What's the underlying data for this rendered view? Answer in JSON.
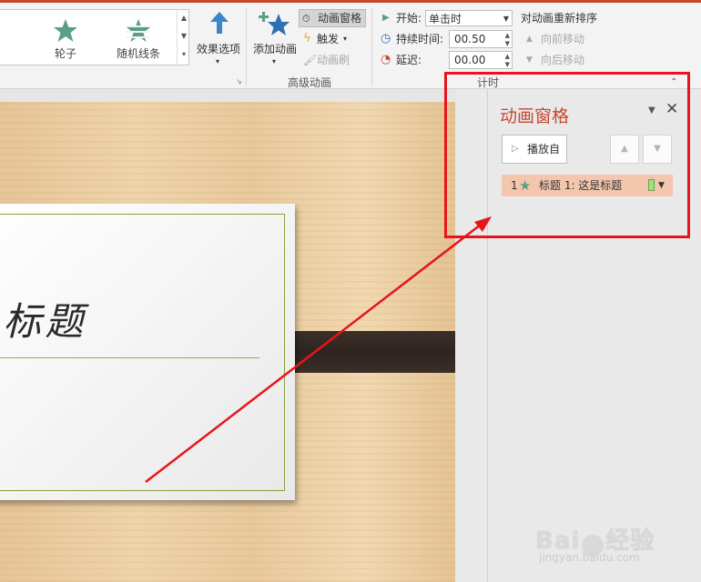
{
  "ribbon": {
    "gallery": {
      "items": [
        {
          "label": "轮子",
          "icon": "wheel-star-icon"
        },
        {
          "label": "随机线条",
          "icon": "random-bars-star-icon"
        }
      ]
    },
    "effect_options_label": "效果选项",
    "add_animation_label": "添加动画",
    "advanced": {
      "animation_pane_label": "动画窗格",
      "trigger_label": "触发",
      "painter_label": "动画刷",
      "group_label": "高级动画"
    },
    "timing": {
      "start_label": "开始:",
      "start_value": "单击时",
      "duration_label": "持续时间:",
      "duration_value": "00.50",
      "delay_label": "延迟:",
      "delay_value": "00.00",
      "reorder_label": "对动画重新排序",
      "move_earlier_label": "向前移动",
      "move_later_label": "向后移动",
      "group_label": "计时"
    }
  },
  "slide": {
    "title_text": "标题"
  },
  "pane": {
    "title": "动画窗格",
    "play_label": "播放自",
    "items": [
      {
        "number": "1",
        "name": "标题 1: 这是标题",
        "effect_color": "#5a9e86"
      }
    ]
  },
  "watermark": {
    "logo_a": "Bai",
    "logo_b": "经验",
    "url": "jingyan.baidu.com"
  },
  "colors": {
    "accent": "#c5482e",
    "highlight": "#e8141a",
    "effect_star": "#5a9e86"
  }
}
